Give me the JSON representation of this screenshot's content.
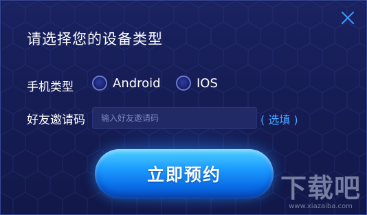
{
  "dialog": {
    "title": "请选择您的设备类型",
    "device_label": "手机类型",
    "options": [
      {
        "label": "Android"
      },
      {
        "label": "IOS"
      }
    ],
    "invite_label": "好友邀请码",
    "invite_placeholder": "输入好友邀请码",
    "invite_value": "",
    "optional_hint": "( 选填 )",
    "submit_label": "立即预约"
  },
  "watermark": {
    "main": "下载吧",
    "url": "www.xiazaiba.com"
  },
  "colors": {
    "background": "#161d55",
    "accent_blue": "#1c9bff",
    "hint_blue": "#4aa6ff",
    "close_icon": "#3aa0ff"
  },
  "icons": {
    "close": "close-icon",
    "radio": "radio-unselected-icon"
  }
}
